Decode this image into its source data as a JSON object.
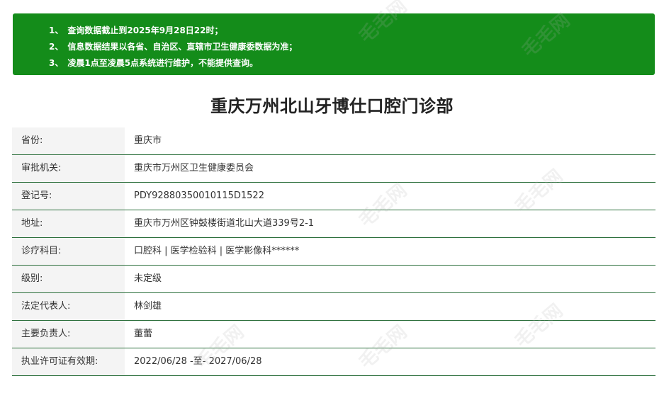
{
  "notice": {
    "lines": [
      {
        "num": "1、",
        "text": "查询数据截止到2025年9月28日22时；"
      },
      {
        "num": "2、",
        "text": "信息数据结果以各省、自治区、直辖市卫生健康委数据为准；"
      },
      {
        "num": "3、",
        "text": "凌晨1点至凌晨5点系统进行维护，不能提供查询。"
      }
    ]
  },
  "title": "重庆万州北山牙博仕口腔门诊部",
  "rows": [
    {
      "label": "省份:",
      "value": "重庆市"
    },
    {
      "label": "审批机关:",
      "value": "重庆市万州区卫生健康委员会"
    },
    {
      "label": "登记号:",
      "value": "PDY92880350010115D1522"
    },
    {
      "label": "地址:",
      "value": "重庆市万州区钟鼓楼街道北山大道339号2-1"
    },
    {
      "label": "诊疗科目:",
      "value": "口腔科 | 医学检验科 | 医学影像科******"
    },
    {
      "label": "级别:",
      "value": "未定级"
    },
    {
      "label": "法定代表人:",
      "value": "林剑雄"
    },
    {
      "label": "主要负责人:",
      "value": "董蕾"
    },
    {
      "label": "执业许可证有效期:",
      "value": "2022/06/28 -至- 2027/06/28"
    }
  ],
  "watermark": {
    "text": "毛毛网"
  },
  "colors": {
    "notice_bg": "#148c1a",
    "row_border": "#2a6e3a",
    "label_bg": "#f4f4f4"
  }
}
